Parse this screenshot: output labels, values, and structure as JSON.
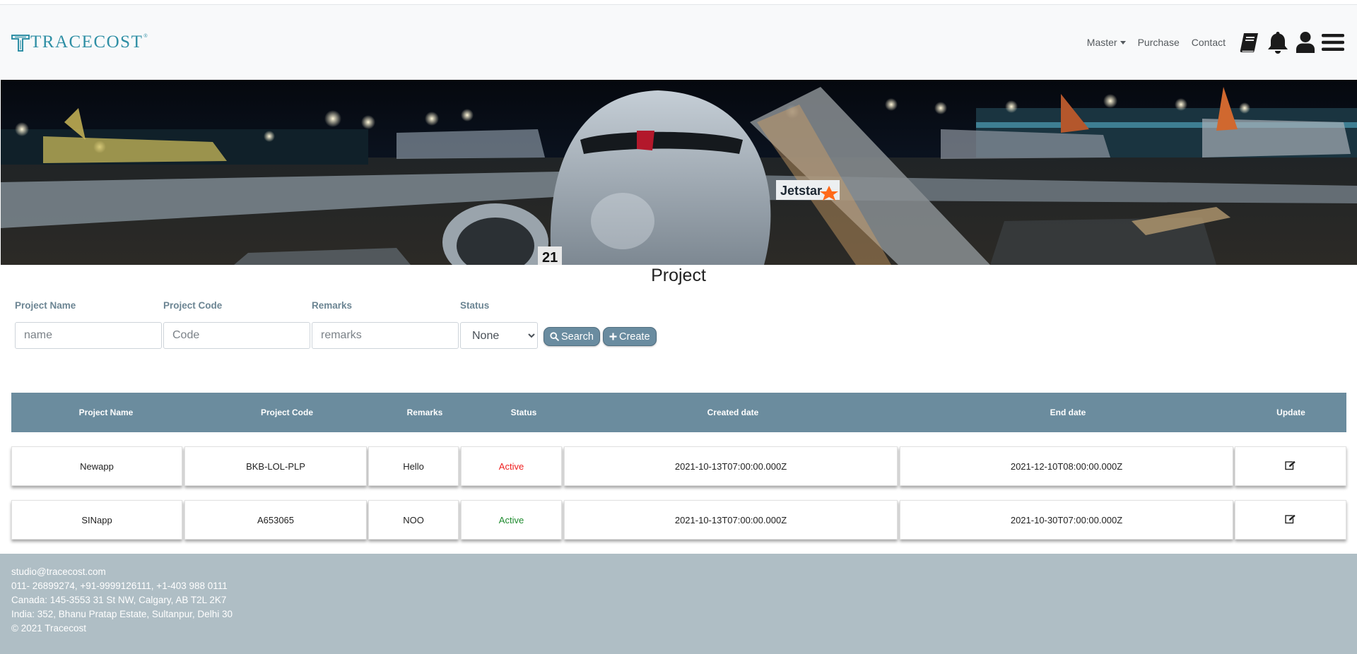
{
  "nav": {
    "brand": "TRACECOST",
    "brand_mark": "®",
    "links": [
      {
        "label": "Master",
        "dropdown": true
      },
      {
        "label": "Purchase",
        "dropdown": false
      },
      {
        "label": "Contact",
        "dropdown": false
      }
    ],
    "icons": [
      "book-icon",
      "bell-icon",
      "user-icon",
      "hamburger-menu-icon"
    ]
  },
  "hero": {
    "tail_text": "Jetstar",
    "stand_number": "21"
  },
  "page": {
    "title": "Project"
  },
  "filters": {
    "project_name": {
      "label": "Project Name",
      "placeholder": "name",
      "value": ""
    },
    "project_code": {
      "label": "Project Code",
      "placeholder": "Code",
      "value": ""
    },
    "remarks": {
      "label": "Remarks",
      "placeholder": "remarks",
      "value": ""
    },
    "status": {
      "label": "Status",
      "selected": "None"
    }
  },
  "buttons": {
    "search": "Search",
    "create": "Create"
  },
  "table": {
    "headers": [
      "Project Name",
      "Project Code",
      "Remarks",
      "Status",
      "Created date",
      "End date",
      "Update"
    ],
    "rows": [
      {
        "name": "Newapp",
        "code": "BKB-LOL-PLP",
        "remarks": "Hello",
        "status": "Active",
        "created": "2021-10-13T07:00:00.000Z",
        "end": "2021-12-10T08:00:00.000Z"
      },
      {
        "name": "SINapp",
        "code": "A653065",
        "remarks": "NOO",
        "status": "Active",
        "created": "2021-10-13T07:00:00.000Z",
        "end": "2021-10-30T07:00:00.000Z"
      }
    ]
  },
  "footer": {
    "email": "studio@tracecost.com",
    "phones": "011- 26899274, +91-9999126111, +1-403 988 0111",
    "canada": "Canada: 145-3553 31 St NW, Calgary, AB T2L 2K7",
    "india": "India: 352, Bhanu Pratap Estate, Sultanpur, Delhi 30",
    "copyright": "© 2021 Tracecost"
  },
  "colors": {
    "table_header": "#6b8c9e",
    "button": "#6a8ca0",
    "footer": "#afbec5",
    "status_red": "#ef1e1e",
    "status_green": "#1e8a2e",
    "brand": "#2f8fa5"
  }
}
